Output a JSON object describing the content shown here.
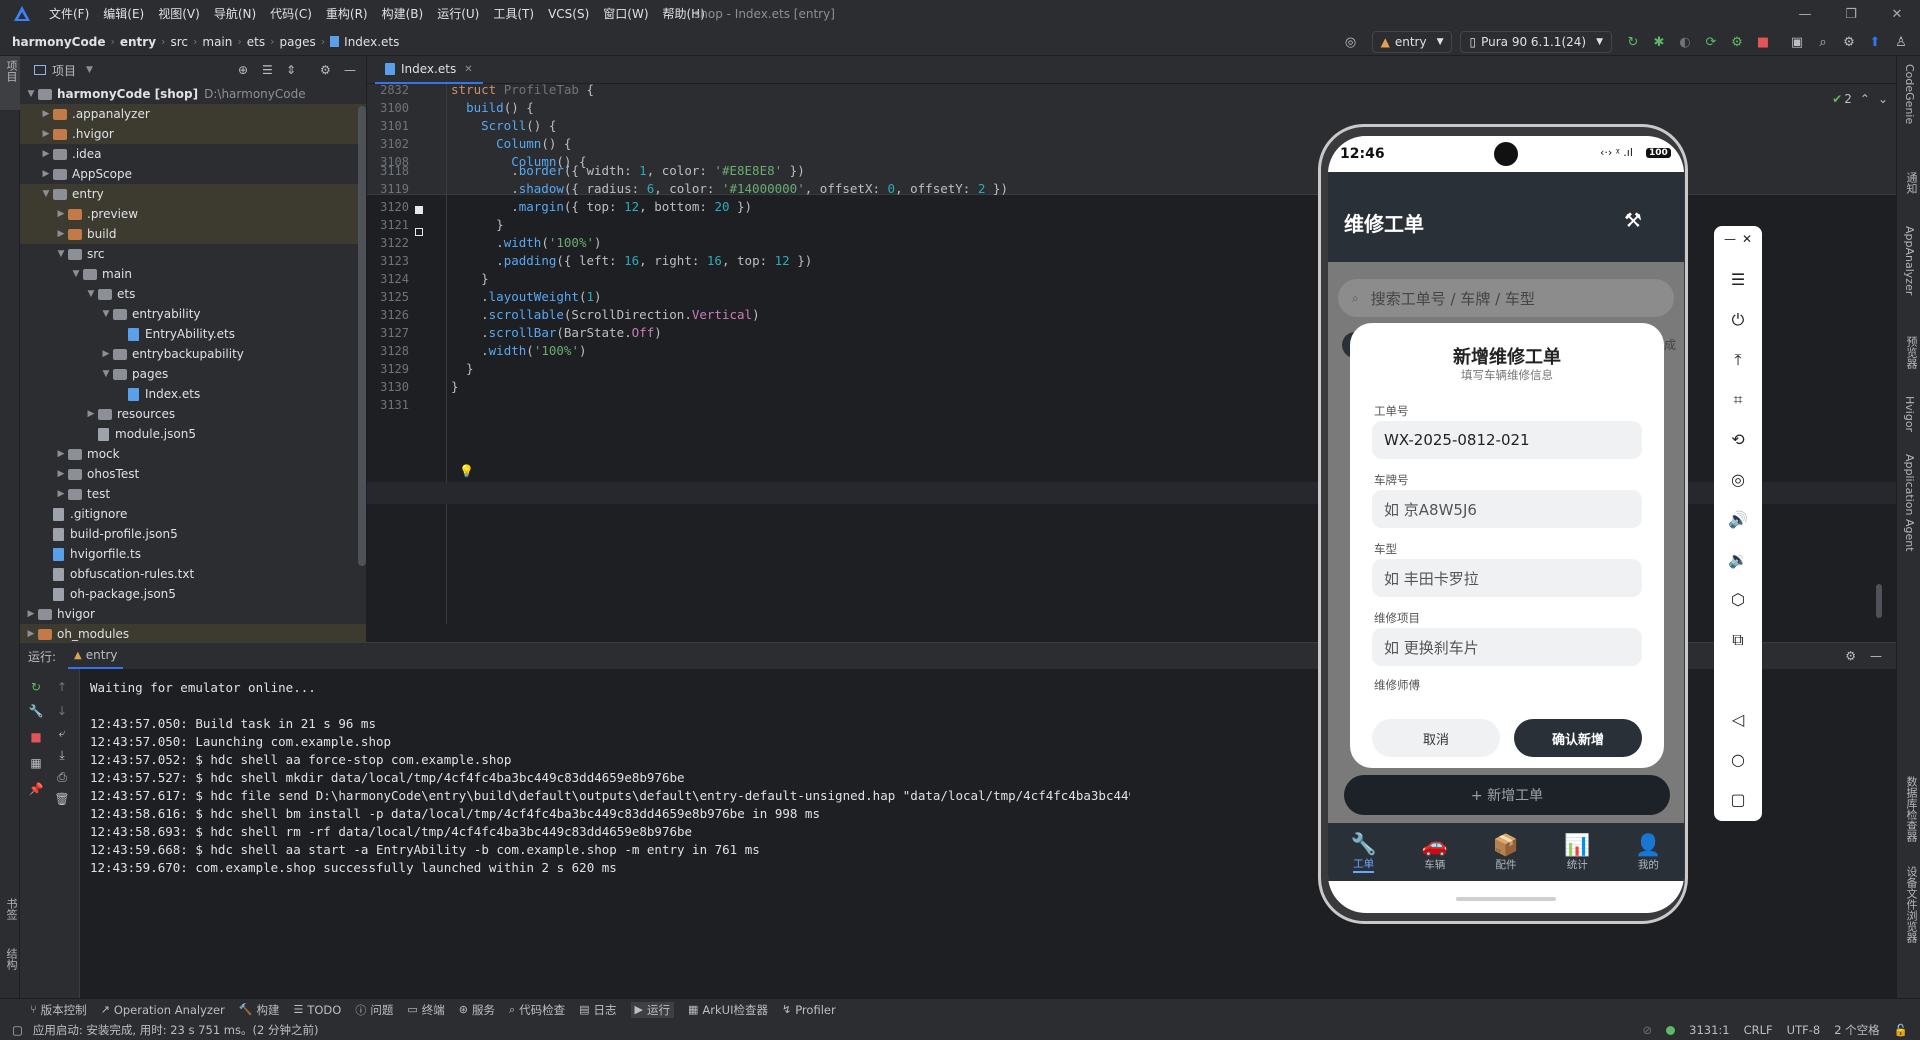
{
  "window": {
    "title": "shop - Index.ets [entry]",
    "menu": [
      "文件(F)",
      "编辑(E)",
      "视图(V)",
      "导航(N)",
      "代码(C)",
      "重构(R)",
      "构建(B)",
      "运行(U)",
      "工具(T)",
      "VCS(S)",
      "窗口(W)",
      "帮助(H)"
    ]
  },
  "breadcrumb": [
    "harmonyCode",
    "entry",
    "src",
    "main",
    "ets",
    "pages",
    "Index.ets"
  ],
  "toolbar": {
    "run_config": "entry",
    "device": "Pura 90 6.1.1(24)"
  },
  "project_panel": {
    "title": "项目",
    "tree": [
      {
        "depth": 0,
        "arrow": "open",
        "kind": "folder-grey",
        "label": "harmonyCode [shop]",
        "sub": "D:\\harmonyCode",
        "hl": false
      },
      {
        "depth": 1,
        "arrow": "closed",
        "kind": "folder-orange",
        "label": ".appanalyzer",
        "hl": true
      },
      {
        "depth": 1,
        "arrow": "closed",
        "kind": "folder-orange",
        "label": ".hvigor",
        "hl": true
      },
      {
        "depth": 1,
        "arrow": "closed",
        "kind": "folder-grey",
        "label": ".idea",
        "hl": false
      },
      {
        "depth": 1,
        "arrow": "closed",
        "kind": "folder-grey",
        "label": "AppScope",
        "hl": false
      },
      {
        "depth": 1,
        "arrow": "open",
        "kind": "folder-grey",
        "label": "entry",
        "hl": true
      },
      {
        "depth": 2,
        "arrow": "closed",
        "kind": "folder-orange",
        "label": ".preview",
        "hl": true
      },
      {
        "depth": 2,
        "arrow": "closed",
        "kind": "folder-orange",
        "label": "build",
        "hl": true
      },
      {
        "depth": 2,
        "arrow": "open",
        "kind": "folder-grey",
        "label": "src",
        "hl": false
      },
      {
        "depth": 3,
        "arrow": "open",
        "kind": "folder-grey",
        "label": "main",
        "hl": false
      },
      {
        "depth": 4,
        "arrow": "open",
        "kind": "folder-grey",
        "label": "ets",
        "hl": false
      },
      {
        "depth": 5,
        "arrow": "open",
        "kind": "folder-grey",
        "label": "entryability",
        "hl": false
      },
      {
        "depth": 6,
        "arrow": "none",
        "kind": "file-ets",
        "label": "EntryAbility.ets",
        "hl": false
      },
      {
        "depth": 5,
        "arrow": "closed",
        "kind": "folder-grey",
        "label": "entrybackupability",
        "hl": false
      },
      {
        "depth": 5,
        "arrow": "open",
        "kind": "folder-grey",
        "label": "pages",
        "hl": false
      },
      {
        "depth": 6,
        "arrow": "none",
        "kind": "file-ets",
        "label": "Index.ets",
        "hl": false
      },
      {
        "depth": 4,
        "arrow": "closed",
        "kind": "folder-grey",
        "label": "resources",
        "hl": false
      },
      {
        "depth": 4,
        "arrow": "none",
        "kind": "file-json",
        "label": "module.json5",
        "hl": false
      },
      {
        "depth": 2,
        "arrow": "closed",
        "kind": "folder-grey",
        "label": "mock",
        "hl": false
      },
      {
        "depth": 2,
        "arrow": "closed",
        "kind": "folder-grey",
        "label": "ohosTest",
        "hl": false
      },
      {
        "depth": 2,
        "arrow": "closed",
        "kind": "folder-grey",
        "label": "test",
        "hl": false
      },
      {
        "depth": 1,
        "arrow": "none",
        "kind": "file-git",
        "label": ".gitignore",
        "hl": false
      },
      {
        "depth": 1,
        "arrow": "none",
        "kind": "file-json",
        "label": "build-profile.json5",
        "hl": false
      },
      {
        "depth": 1,
        "arrow": "none",
        "kind": "file-ts",
        "label": "hvigorfile.ts",
        "hl": false
      },
      {
        "depth": 1,
        "arrow": "none",
        "kind": "file-txt",
        "label": "obfuscation-rules.txt",
        "hl": false
      },
      {
        "depth": 1,
        "arrow": "none",
        "kind": "file-json",
        "label": "oh-package.json5",
        "hl": false
      },
      {
        "depth": 0,
        "arrow": "closed",
        "kind": "folder-grey",
        "label": "hvigor",
        "hl": false
      },
      {
        "depth": 0,
        "arrow": "closed",
        "kind": "folder-orange",
        "label": "oh_modules",
        "hl": true
      }
    ]
  },
  "editor": {
    "tab": "Index.ets",
    "inspection_count": "2",
    "sticky_lines": [
      {
        "n": "2832",
        "code": [
          [
            "kw",
            "struct "
          ],
          [
            "ty",
            "ProfileTab "
          ],
          [
            "pr",
            "{"
          ]
        ]
      },
      {
        "n": "3100",
        "code": [
          [
            "pr",
            "  "
          ],
          [
            "fn",
            "build"
          ],
          [
            "pr",
            "() {"
          ]
        ]
      },
      {
        "n": "3101",
        "code": [
          [
            "pr",
            "    "
          ],
          [
            "fn",
            "Scroll"
          ],
          [
            "pr",
            "() {"
          ]
        ]
      },
      {
        "n": "3102",
        "code": [
          [
            "pr",
            "      "
          ],
          [
            "fn",
            "Column"
          ],
          [
            "pr",
            "() {"
          ]
        ]
      },
      {
        "n": "3108",
        "code": [
          [
            "pr",
            "        "
          ],
          [
            "fn",
            "Column"
          ],
          [
            "pr",
            "() {"
          ]
        ]
      }
    ],
    "lines": [
      {
        "n": "3118",
        "code": [
          [
            "pr",
            "        ."
          ],
          [
            "fn",
            "border"
          ],
          [
            "pr",
            "({ width: "
          ],
          [
            "num",
            "1"
          ],
          [
            "pr",
            ", color: "
          ],
          [
            "str",
            "'#E8E8E8'"
          ],
          [
            "pr",
            " })"
          ]
        ]
      },
      {
        "n": "3119",
        "code": [
          [
            "pr",
            "        ."
          ],
          [
            "fn",
            "shadow"
          ],
          [
            "pr",
            "({ radius: "
          ],
          [
            "num",
            "6"
          ],
          [
            "pr",
            ", color: "
          ],
          [
            "str",
            "'#14000000'"
          ],
          [
            "pr",
            ", offsetX: "
          ],
          [
            "num",
            "0"
          ],
          [
            "pr",
            ", offsetY: "
          ],
          [
            "num",
            "2"
          ],
          [
            "pr",
            " })"
          ]
        ]
      },
      {
        "n": "3120",
        "code": [
          [
            "pr",
            "        ."
          ],
          [
            "fn",
            "margin"
          ],
          [
            "pr",
            "({ top: "
          ],
          [
            "num",
            "12"
          ],
          [
            "pr",
            ", bottom: "
          ],
          [
            "num",
            "20"
          ],
          [
            "pr",
            " })"
          ]
        ]
      },
      {
        "n": "3121",
        "code": [
          [
            "pr",
            "      }"
          ]
        ]
      },
      {
        "n": "3122",
        "code": [
          [
            "pr",
            "      ."
          ],
          [
            "fn",
            "width"
          ],
          [
            "pr",
            "("
          ],
          [
            "str",
            "'100%'"
          ],
          [
            "pr",
            ")"
          ]
        ]
      },
      {
        "n": "3123",
        "code": [
          [
            "pr",
            "      ."
          ],
          [
            "fn",
            "padding"
          ],
          [
            "pr",
            "({ left: "
          ],
          [
            "num",
            "16"
          ],
          [
            "pr",
            ", right: "
          ],
          [
            "num",
            "16"
          ],
          [
            "pr",
            ", top: "
          ],
          [
            "num",
            "12"
          ],
          [
            "pr",
            " })"
          ]
        ]
      },
      {
        "n": "3124",
        "code": [
          [
            "pr",
            "    }"
          ]
        ]
      },
      {
        "n": "3125",
        "code": [
          [
            "pr",
            "    ."
          ],
          [
            "fn",
            "layoutWeight"
          ],
          [
            "pr",
            "("
          ],
          [
            "num",
            "1"
          ],
          [
            "pr",
            ")"
          ]
        ]
      },
      {
        "n": "3126",
        "code": [
          [
            "pr",
            "    ."
          ],
          [
            "fn",
            "scrollable"
          ],
          [
            "pr",
            "(ScrollDirection."
          ],
          [
            "at",
            "Vertical"
          ],
          [
            "pr",
            ")"
          ]
        ]
      },
      {
        "n": "3127",
        "code": [
          [
            "pr",
            "    ."
          ],
          [
            "fn",
            "scrollBar"
          ],
          [
            "pr",
            "(BarState."
          ],
          [
            "at",
            "Off"
          ],
          [
            "pr",
            ")"
          ]
        ]
      },
      {
        "n": "3128",
        "code": [
          [
            "pr",
            "    ."
          ],
          [
            "fn",
            "width"
          ],
          [
            "pr",
            "("
          ],
          [
            "str",
            "'100%'"
          ],
          [
            "pr",
            ")"
          ]
        ]
      },
      {
        "n": "3129",
        "code": [
          [
            "pr",
            "  }"
          ]
        ]
      },
      {
        "n": "3130",
        "code": [
          [
            "pr",
            "}"
          ]
        ]
      },
      {
        "n": "3131",
        "code": []
      }
    ]
  },
  "run_panel": {
    "label": "运行:",
    "tab": "entry",
    "log": [
      "Waiting for emulator online...",
      "",
      "12:43:57.050: Build task in 21 s 96 ms",
      "12:43:57.050: Launching com.example.shop",
      "12:43:57.052: $ hdc shell aa force-stop com.example.shop",
      "12:43:57.527: $ hdc shell mkdir data/local/tmp/4cf4fc4ba3bc449c83dd4659e8b976be",
      "12:43:57.617: $ hdc file send D:\\harmonyCode\\entry\\build\\default\\outputs\\default\\entry-default-unsigned.hap \"data/local/tmp/4cf4fc4ba3bc449c83dd4659e8b97",
      "12:43:58.616: $ hdc shell bm install -p data/local/tmp/4cf4fc4ba3bc449c83dd4659e8b976be in 998 ms",
      "12:43:58.693: $ hdc shell rm -rf data/local/tmp/4cf4fc4ba3bc449c83dd4659e8b976be",
      "12:43:59.668: $ hdc shell aa start -a EntryAbility -b com.example.shop -m entry in 761 ms",
      "12:43:59.670: com.example.shop successfully launched within 2 s 620 ms"
    ]
  },
  "tool_tabs": [
    "版本控制",
    "Operation Analyzer",
    "构建",
    "TODO",
    "问题",
    "终端",
    "服务",
    "代码检查",
    "日志",
    "运行",
    "ArkUI检查器",
    "Profiler"
  ],
  "status": {
    "message": "应用启动: 安装完成, 用时: 23 s 751 ms。(2 分钟之前)",
    "position": "3131:1",
    "line_sep": "CRLF",
    "encoding": "UTF-8",
    "indent": "2 个空格"
  },
  "right_strip_labels": [
    "CodeGenie",
    "通知",
    "AppAnalyzer",
    "预览器",
    "Hvigor",
    "Application Agent",
    "数据库检查器",
    "设备文件浏览器"
  ],
  "left_strip_labels": [
    "项目",
    "书签",
    "结构"
  ],
  "emulator": {
    "time": "12:46",
    "battery": "100",
    "app_title": "维修工单",
    "search_placeholder": "搜索工单号 / 车牌 / 车型",
    "dialog": {
      "title": "新增维修工单",
      "subtitle": "填写车辆维修信息",
      "fields": [
        {
          "label": "工单号",
          "value": "WX-2025-0812-021",
          "is_placeholder": false
        },
        {
          "label": "车牌号",
          "value": "如 京A8W5J6",
          "is_placeholder": true
        },
        {
          "label": "车型",
          "value": "如 丰田卡罗拉",
          "is_placeholder": true
        },
        {
          "label": "维修项目",
          "value": "如 更换刹车片",
          "is_placeholder": true
        }
      ],
      "extra_label": "维修师傅",
      "cancel": "取消",
      "confirm": "确认新增"
    },
    "add_button": "+ 新增工单",
    "nav": [
      {
        "icon": "wrench-icon",
        "glyph": "🔧",
        "label": "工单",
        "active": true
      },
      {
        "icon": "car-icon",
        "glyph": "🚗",
        "label": "车辆",
        "active": false
      },
      {
        "icon": "box-icon",
        "glyph": "📦",
        "label": "配件",
        "active": false
      },
      {
        "icon": "chart-icon",
        "glyph": "📊",
        "label": "统计",
        "active": false
      },
      {
        "icon": "user-icon",
        "glyph": "👤",
        "label": "我的",
        "active": false
      }
    ],
    "accent": "#2a3038"
  }
}
